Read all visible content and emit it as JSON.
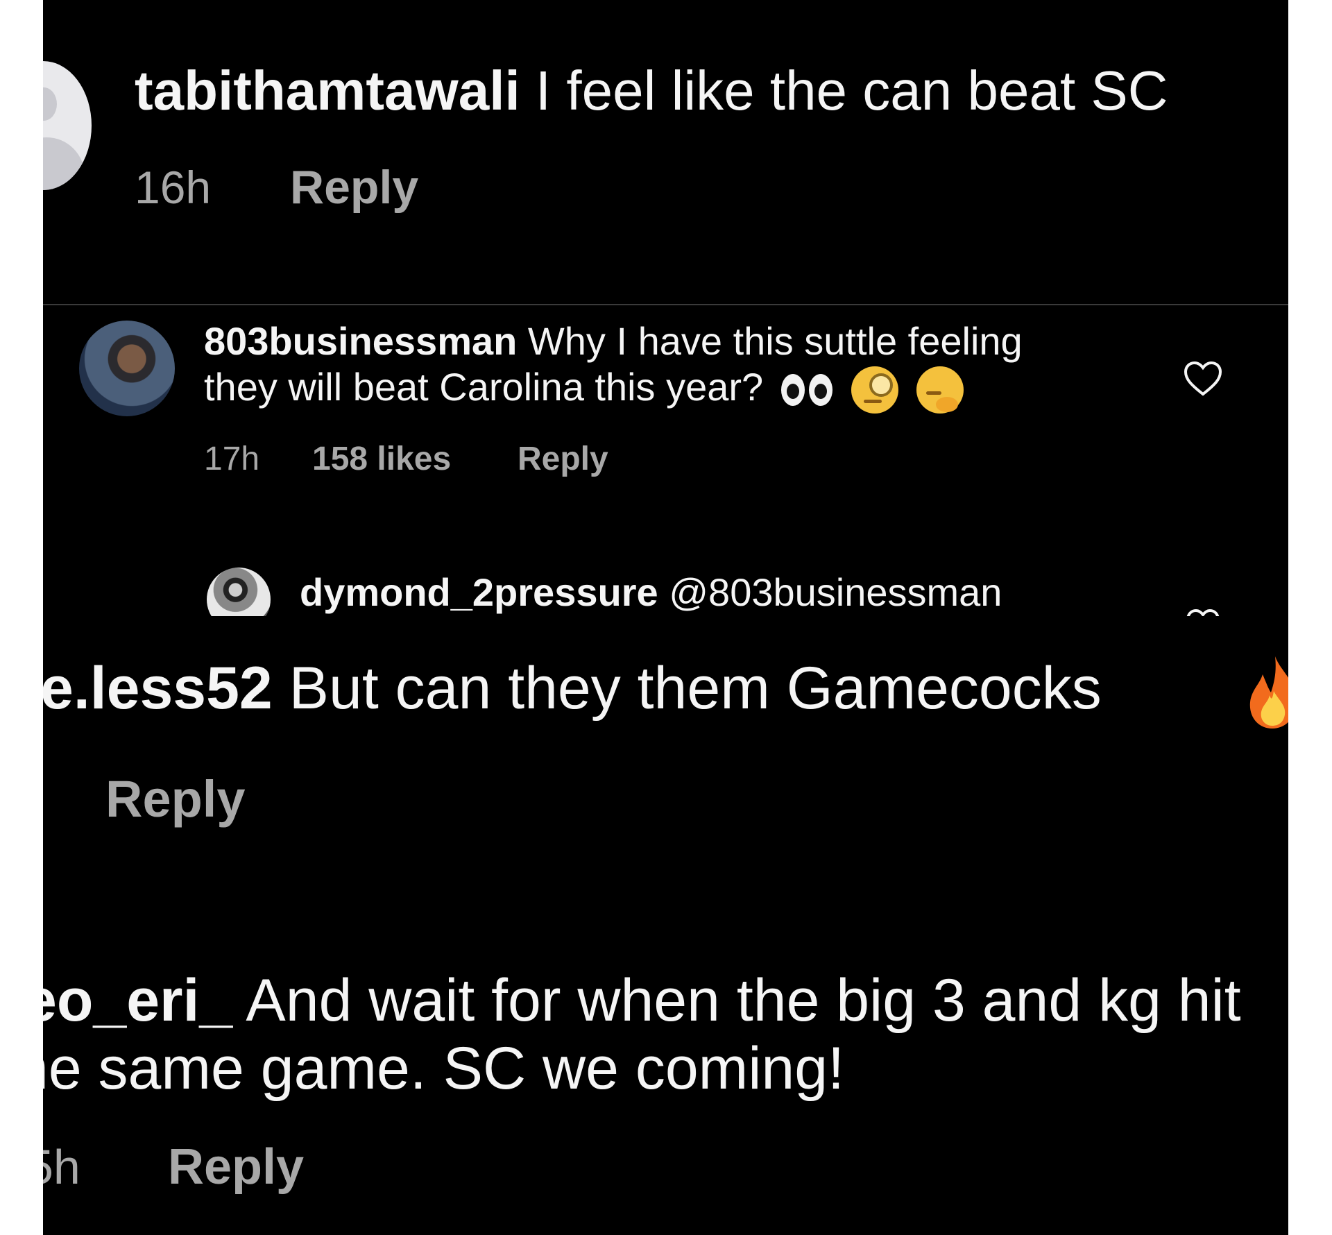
{
  "comment1": {
    "username": "tabithamtawali",
    "text": "I feel like the can beat SC",
    "time": "16h",
    "reply": "Reply"
  },
  "comment2": {
    "username": "803businessman",
    "text_line1": "Why I have this suttle feeling",
    "text_line2": "they will beat Carolina this year?",
    "emojis": [
      "eyes-emoji",
      "face-with-monocle-emoji",
      "thinking-face-emoji"
    ],
    "time": "17h",
    "likes": "158 likes",
    "reply": "Reply"
  },
  "comment2_reply": {
    "username": "dymond_2pressure",
    "text": "@803businessman"
  },
  "comment3": {
    "username": "e.less52",
    "text": "But can they them Gamecocks",
    "emoji": "fire-emoji",
    "reply": "Reply"
  },
  "comment4": {
    "username": "eo_eri_",
    "text_line1": "And wait for when the big 3 and kg hit",
    "text_line2": "ne same game. SC we coming!",
    "time": "5h",
    "reply": "Reply"
  },
  "colors": {
    "background": "#000000",
    "text": "#f5f5f5",
    "muted": "#a8a8a8"
  }
}
